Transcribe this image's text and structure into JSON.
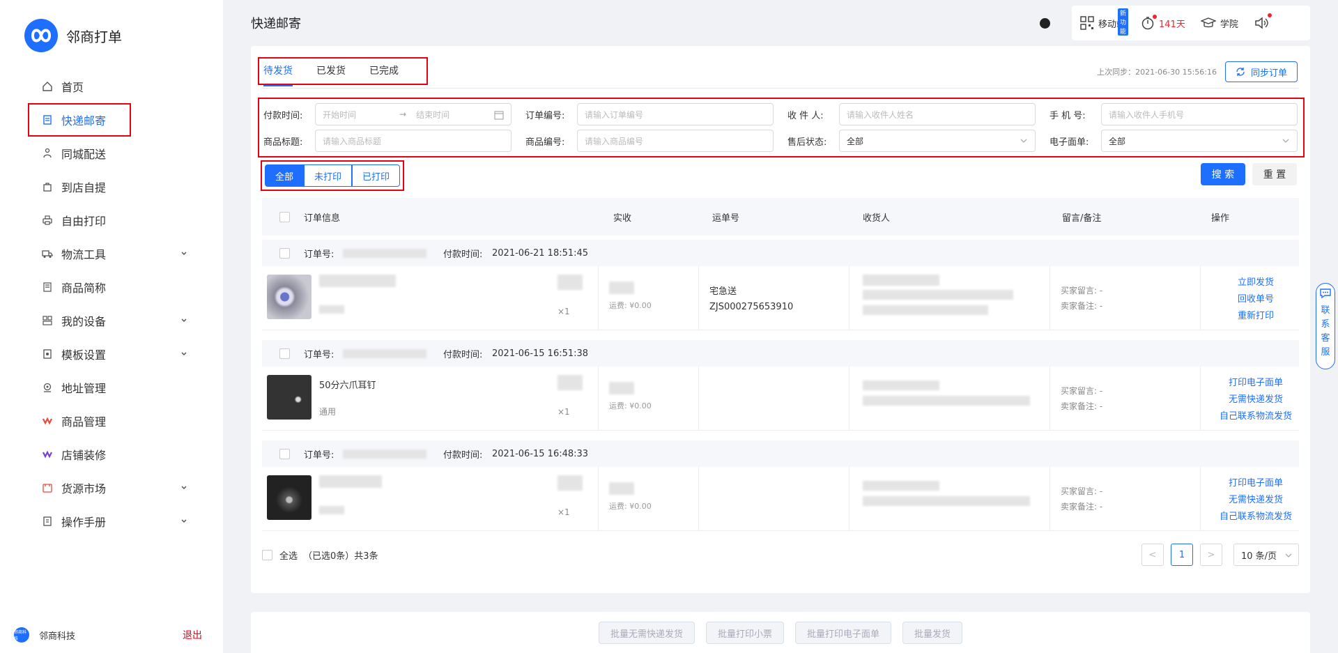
{
  "brand": {
    "name": "邻商打单",
    "accent": "#1e6fff",
    "highlight": "#e60012"
  },
  "sidebar": {
    "items": [
      {
        "label": "首页",
        "icon": "home-icon"
      },
      {
        "label": "快递邮寄",
        "icon": "document-icon"
      },
      {
        "label": "同城配送",
        "icon": "courier-icon"
      },
      {
        "label": "到店自提",
        "icon": "bag-icon"
      },
      {
        "label": "自由打印",
        "icon": "printer-icon"
      },
      {
        "label": "物流工具",
        "icon": "truck-icon"
      },
      {
        "label": "商品简称",
        "icon": "tag-icon"
      },
      {
        "label": "我的设备",
        "icon": "device-icon"
      },
      {
        "label": "模板设置",
        "icon": "template-icon"
      },
      {
        "label": "地址管理",
        "icon": "location-icon"
      },
      {
        "label": "商品管理",
        "icon": "goods-icon"
      },
      {
        "label": "店铺装修",
        "icon": "decorate-icon"
      },
      {
        "label": "货源市场",
        "icon": "market-icon"
      },
      {
        "label": "操作手册",
        "icon": "manual-icon"
      }
    ],
    "footer": {
      "avatar_text": "邻商科技",
      "company": "邻商科技",
      "logout": "退出"
    }
  },
  "topbar": {
    "title": "快递邮寄",
    "mobile": "移动端",
    "new_badge": "新功能",
    "days": "141天",
    "academy": "学院"
  },
  "tabs": [
    "待发货",
    "已发货",
    "已完成"
  ],
  "sync": {
    "last": "上次同步：2021-06-30 15:56:16",
    "button": "同步订单"
  },
  "filters": {
    "pay_time": {
      "label": "付款时间:",
      "start": "开始时间",
      "end": "结束时间"
    },
    "order_no": {
      "label": "订单编号:",
      "placeholder": "请输入订单编号"
    },
    "receiver": {
      "label": "收 件 人:",
      "placeholder": "请输入收件人姓名"
    },
    "phone": {
      "label": "手 机 号:",
      "placeholder": "请输入收件人手机号"
    },
    "goods_title": {
      "label": "商品标题:",
      "placeholder": "请输入商品标题"
    },
    "goods_no": {
      "label": "商品编号:",
      "placeholder": "请输入商品编号"
    },
    "after_sale": {
      "label": "售后状态:",
      "value": "全部"
    },
    "waybill": {
      "label": "电子面单:",
      "value": "全部"
    }
  },
  "print_filter": [
    "全部",
    "未打印",
    "已打印"
  ],
  "actions": {
    "search": "搜 索",
    "reset": "重 置"
  },
  "table": {
    "headers": [
      "订单信息",
      "实收",
      "运单号",
      "收货人",
      "留言/备注",
      "操作"
    ]
  },
  "orders": [
    {
      "order_label": "订单号:",
      "pay_label": "付款时间:",
      "pay_time": "2021-06-21 18:51:45",
      "title": "",
      "spec": "",
      "qty": "×1",
      "freight": "运费: ¥0.00",
      "carrier": "宅急送",
      "tracking": "ZJS000275653910",
      "buyer_note": "买家留言: -",
      "seller_note": "卖家备注: -",
      "ops": [
        "立即发货",
        "回收单号",
        "重新打印"
      ]
    },
    {
      "order_label": "订单号:",
      "pay_label": "付款时间:",
      "pay_time": "2021-06-15 16:51:38",
      "title": "50分六爪耳钉",
      "spec": "通用",
      "qty": "×1",
      "freight": "运费: ¥0.00",
      "carrier": "",
      "tracking": "",
      "buyer_note": "买家留言: -",
      "seller_note": "卖家备注: -",
      "ops": [
        "打印电子面单",
        "无需快递发货",
        "自己联系物流发货"
      ]
    },
    {
      "order_label": "订单号:",
      "pay_label": "付款时间:",
      "pay_time": "2021-06-15 16:48:33",
      "title": "",
      "spec": "",
      "qty": "×1",
      "freight": "运费: ¥0.00",
      "carrier": "",
      "tracking": "",
      "buyer_note": "买家留言: -",
      "seller_note": "卖家备注: -",
      "ops": [
        "打印电子面单",
        "无需快递发货",
        "自己联系物流发货"
      ]
    }
  ],
  "footer": {
    "select_all": "全选",
    "selected": "（已选0条）",
    "total": "共3条",
    "page": "1",
    "page_size": "10 条/页",
    "prev": "<",
    "next": ">"
  },
  "batch": [
    "批量无需快递发货",
    "批量打印小票",
    "批量打印电子面单",
    "批量发货"
  ],
  "service": [
    "联",
    "系",
    "客",
    "服"
  ]
}
